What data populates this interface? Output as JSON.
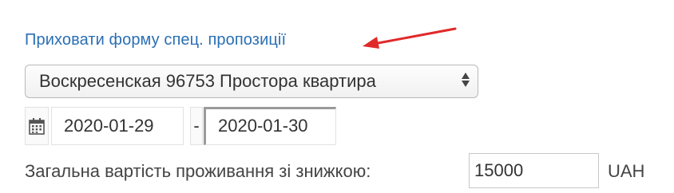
{
  "offer": {
    "toggle_link": "Приховати форму спец. пропозиції",
    "accent_color": "#e02a2a"
  },
  "apartment_select": {
    "selected": "Воскресенская 96753 Простора квартира"
  },
  "dates": {
    "start": "2020-01-29",
    "separator": "-",
    "end": "2020-01-30"
  },
  "total": {
    "label": "Загальна вартість проживання зі знижкою:",
    "value": "15000",
    "currency": "UAH"
  },
  "icons": {
    "calendar": "calendar-icon",
    "arrow": "arrow-left-annotation"
  }
}
